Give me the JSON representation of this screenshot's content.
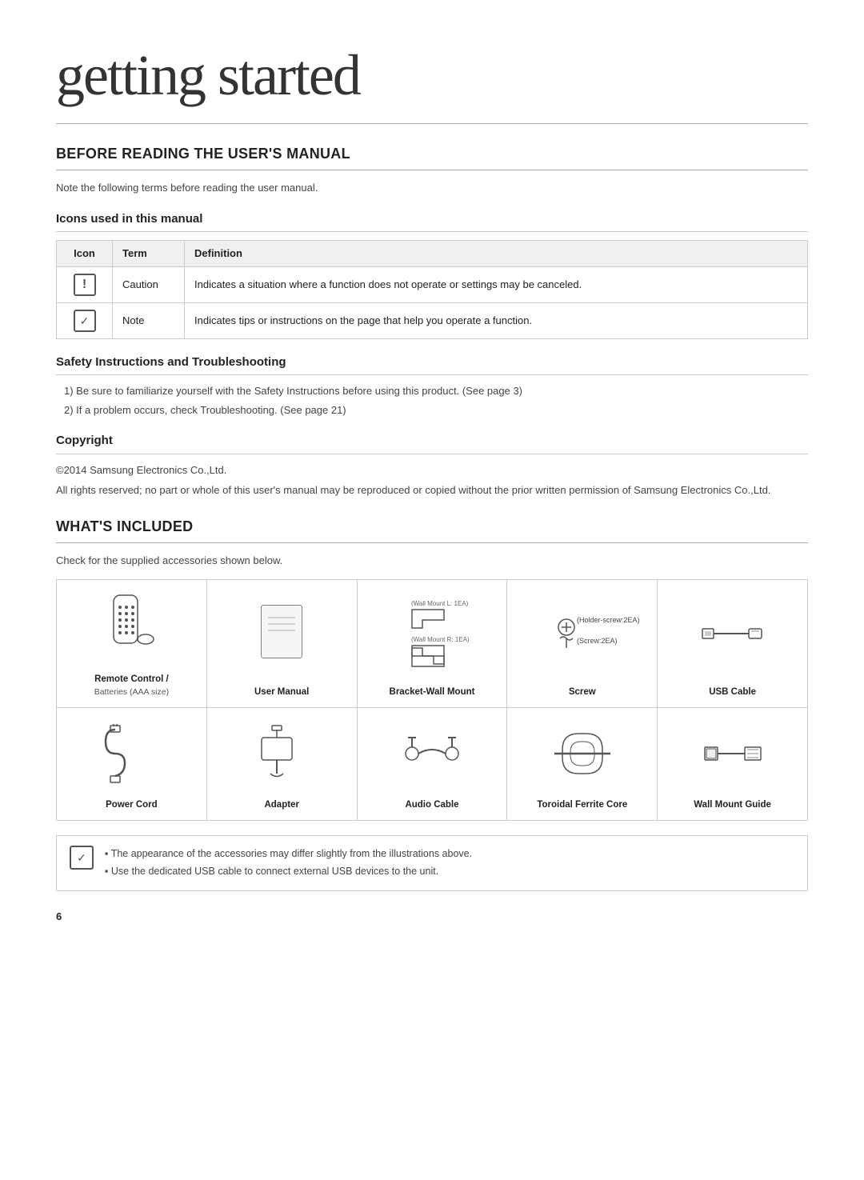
{
  "page": {
    "title": "getting started",
    "page_number": "6"
  },
  "section1": {
    "title": "BEFORE READING THE USER'S MANUAL",
    "intro": "Note the following terms before reading the user manual.",
    "subsection1": {
      "title": "Icons used in this manual",
      "table": {
        "headers": [
          "Icon",
          "Term",
          "Definition"
        ],
        "rows": [
          {
            "icon": "caution",
            "term": "Caution",
            "definition": "Indicates a situation where a function does not operate or settings may be canceled."
          },
          {
            "icon": "note",
            "term": "Note",
            "definition": "Indicates tips or instructions on the page that help you operate a function."
          }
        ]
      }
    },
    "subsection2": {
      "title": "Safety Instructions and Troubleshooting",
      "items": [
        "Be sure to familiarize yourself with the Safety Instructions before using this product. (See page 3)",
        "If a problem occurs, check Troubleshooting. (See page 21)"
      ]
    },
    "subsection3": {
      "title": "Copyright",
      "line1": "©2014 Samsung Electronics Co.,Ltd.",
      "line2": "All rights reserved; no part or whole of this user's manual may be reproduced or copied without the prior written permission of Samsung Electronics Co.,Ltd."
    }
  },
  "section2": {
    "title": "WHAT'S INCLUDED",
    "intro": "Check for the supplied accessories shown below.",
    "accessories_row1": [
      {
        "id": "remote-control",
        "label": "Remote Control /",
        "sublabel": "Batteries (AAA size)"
      },
      {
        "id": "user-manual",
        "label": "User Manual",
        "sublabel": ""
      },
      {
        "id": "bracket-wall-mount",
        "label": "Bracket-Wall Mount",
        "sublabel": ""
      },
      {
        "id": "screw",
        "label": "Screw",
        "sublabel": ""
      },
      {
        "id": "usb-cable",
        "label": "USB Cable",
        "sublabel": ""
      }
    ],
    "accessories_row2": [
      {
        "id": "power-cord",
        "label": "Power Cord",
        "sublabel": ""
      },
      {
        "id": "adapter",
        "label": "Adapter",
        "sublabel": ""
      },
      {
        "id": "audio-cable",
        "label": "Audio Cable",
        "sublabel": ""
      },
      {
        "id": "toroidal-ferrite-core",
        "label": "Toroidal Ferrite Core",
        "sublabel": ""
      },
      {
        "id": "wall-mount-guide",
        "label": "Wall Mount Guide",
        "sublabel": ""
      }
    ],
    "bracket_wall_mount_labels": {
      "top": "(Wall Mount L: 1EA)",
      "bottom": "(Wall Mount R: 1EA)"
    },
    "screw_labels": {
      "line1": "⊕ (Holder-screw:2EA)",
      "line2": "⚲ (Screw:2EA)"
    },
    "notes": [
      "The appearance of the accessories may differ slightly from the illustrations above.",
      "Use the dedicated USB cable to connect external USB devices to the unit."
    ]
  }
}
